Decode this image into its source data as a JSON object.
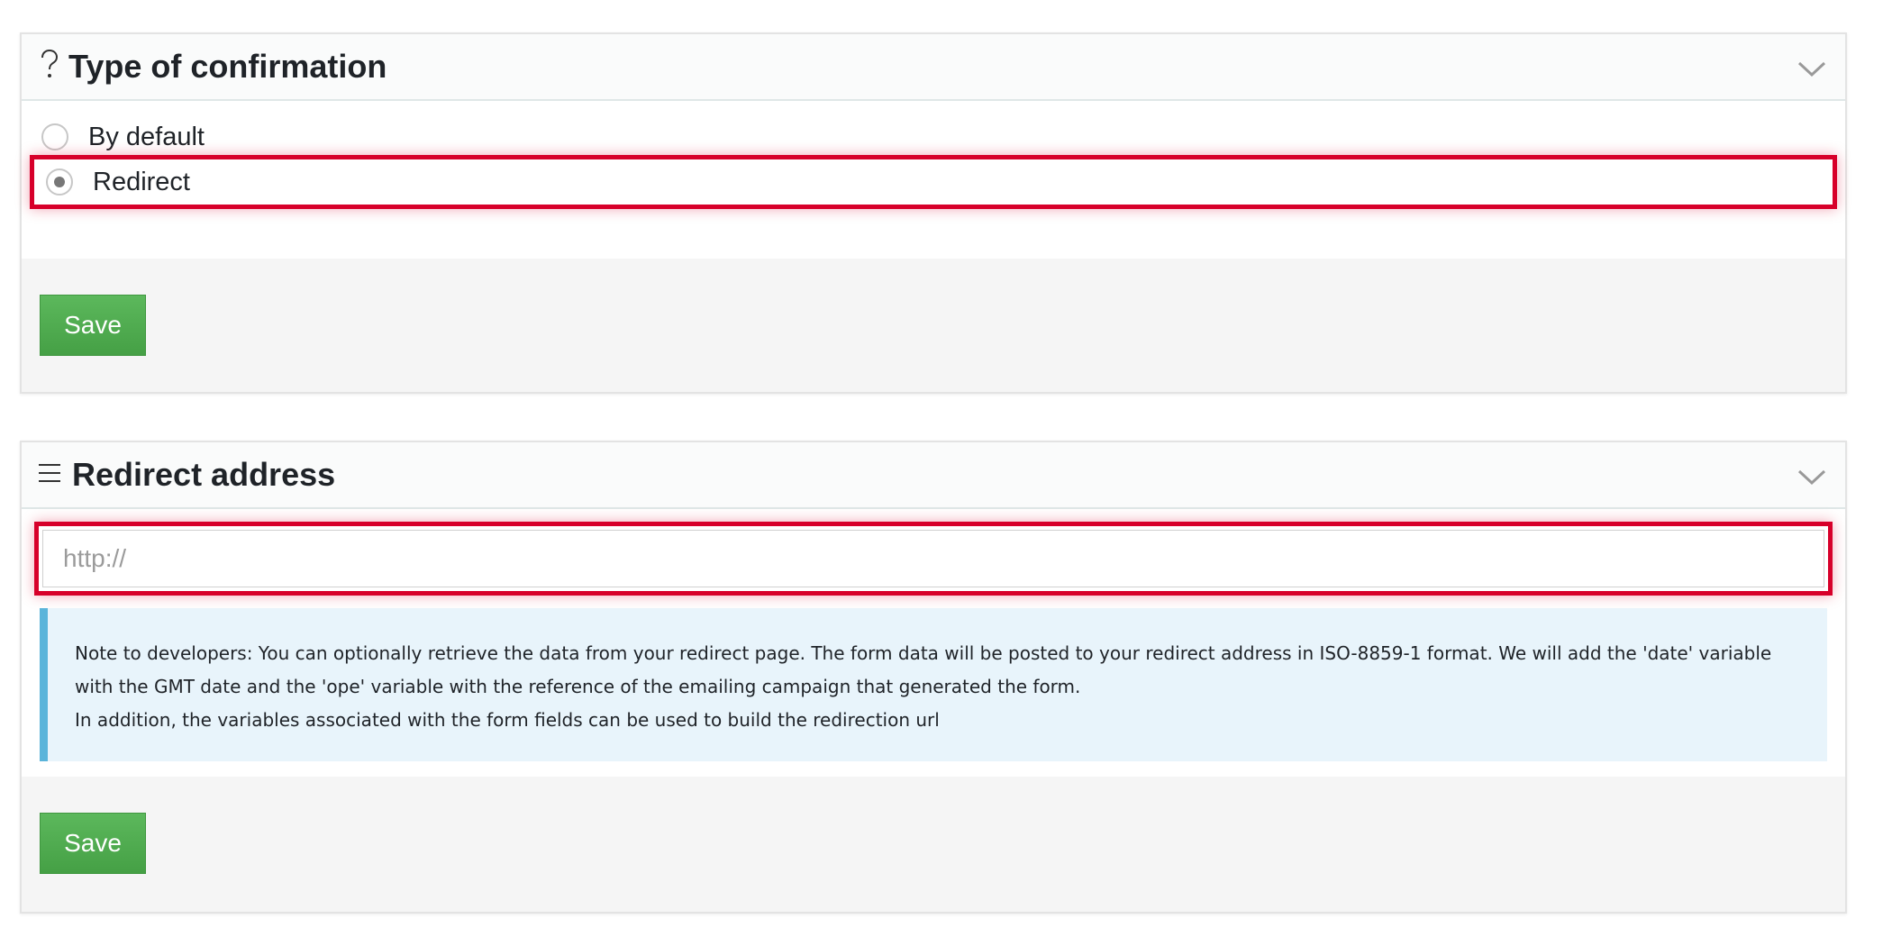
{
  "confirmation_panel": {
    "icon": "question-icon",
    "title": "Type of confirmation",
    "options": [
      {
        "label": "By default",
        "selected": false
      },
      {
        "label": "Redirect",
        "selected": true
      }
    ],
    "save_label": "Save"
  },
  "redirect_panel": {
    "icon": "list-icon",
    "title": "Redirect address",
    "input": {
      "placeholder": "http://",
      "value": ""
    },
    "note_lines": [
      "Note to developers: You can optionally retrieve the data from your redirect page. The form data will be posted to your redirect address in ISO-8859-1 format. We will add the 'date' variable",
      "with the GMT date and the 'ope' variable with the reference of the emailing campaign that generated the form.",
      "In addition, the variables associated with the form fields can be used to build the redirection url"
    ],
    "save_label": "Save"
  },
  "colors": {
    "highlight": "#d7002a",
    "save_button": "#5cb85c",
    "note_background": "#e8f4fb",
    "note_border": "#5ab4da"
  }
}
